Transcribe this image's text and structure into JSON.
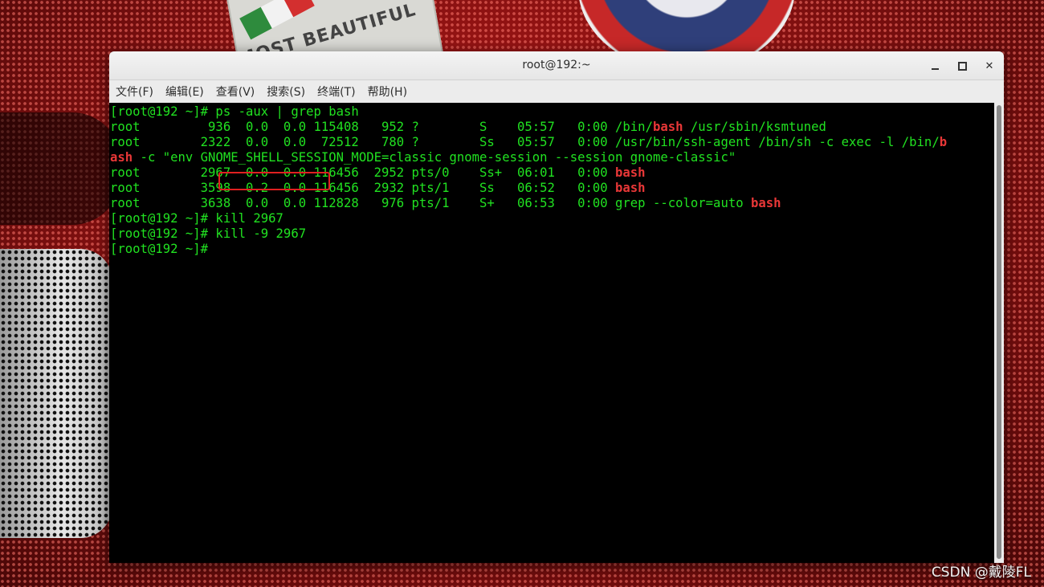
{
  "window": {
    "title": "root@192:~"
  },
  "menu": [
    "文件(F)",
    "编辑(E)",
    "查看(V)",
    "搜索(S)",
    "终端(T)",
    "帮助(H)"
  ],
  "background": {
    "patch_text": "MOST BEAUTIFUL PLACE"
  },
  "terminal": {
    "lines": [
      [
        {
          "t": "[root@192 ~]# ps -aux | grep bash"
        }
      ],
      [
        {
          "t": "root         936  0.0  0.0 115408   952 ?        S    05:57   0:00 /bin/"
        },
        {
          "t": "bash",
          "c": "red"
        },
        {
          "t": " /usr/sbin/ksmtuned"
        }
      ],
      [
        {
          "t": "root        2322  0.0  0.0  72512   780 ?        Ss   05:57   0:00 /usr/bin/ssh-agent /bin/sh -c exec -l /bin/"
        },
        {
          "t": "b",
          "c": "red"
        }
      ],
      [
        {
          "t": "ash",
          "c": "red"
        },
        {
          "t": " -c \"env GNOME_SHELL_SESSION_MODE=classic gnome-session --session gnome-classic\""
        }
      ],
      [
        {
          "t": "root        2967  0.0  0.0 116456  2952 pts/0    Ss+  06:01   0:00 "
        },
        {
          "t": "bash",
          "c": "red"
        }
      ],
      [
        {
          "t": "root        3598  0.2  0.0 116456  2932 pts/1    Ss   06:52   0:00 "
        },
        {
          "t": "bash",
          "c": "red"
        }
      ],
      [
        {
          "t": "root        3638  0.0  0.0 112828   976 pts/1    S+   06:53   0:00 grep --color=auto "
        },
        {
          "t": "bash",
          "c": "red"
        }
      ],
      [
        {
          "t": "[root@192 ~]# kill 2967"
        }
      ],
      [
        {
          "t": "[root@192 ~]# kill -9 2967"
        }
      ],
      [
        {
          "t": "[root@192 ~]#"
        }
      ]
    ]
  },
  "watermark": "CSDN @戴陵FL",
  "colors": {
    "terminal_text": "#21e121",
    "highlight": "#e83737",
    "terminal_bg": "#000000"
  }
}
